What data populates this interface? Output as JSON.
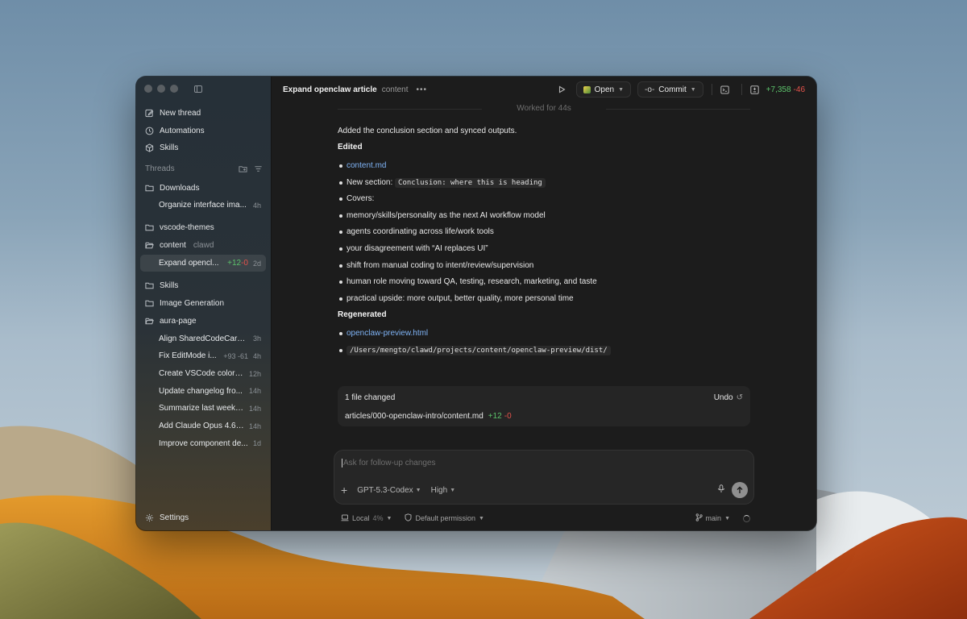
{
  "window": {
    "title": "Expand openclaw article",
    "project": "content"
  },
  "sidebar": {
    "nav": [
      {
        "label": "New thread",
        "icon": "edit-icon"
      },
      {
        "label": "Automations",
        "icon": "clock-icon"
      },
      {
        "label": "Skills",
        "icon": "cube-icon"
      }
    ],
    "threads_header": "Threads",
    "groups": [
      {
        "folder": "Downloads",
        "sub": "",
        "threads": [
          {
            "title": "Organize interface ima...",
            "time": "4h"
          }
        ]
      },
      {
        "folder": "vscode-themes",
        "sub": "",
        "threads": []
      },
      {
        "folder": "content",
        "sub": "clawd",
        "threads": [
          {
            "title": "Expand opencl...",
            "add": "+12",
            "del": "-0",
            "time": "2d",
            "active": true
          }
        ]
      },
      {
        "folder": "Skills",
        "sub": "",
        "threads": []
      },
      {
        "folder": "Image Generation",
        "sub": "",
        "threads": []
      },
      {
        "folder": "aura-page",
        "sub": "",
        "threads": [
          {
            "title": "Align SharedCodeCard ...",
            "time": "3h"
          },
          {
            "title": "Fix EditMode i...",
            "stat": "+93 -61",
            "time": "4h"
          },
          {
            "title": "Create VSCode color t...",
            "time": "12h"
          },
          {
            "title": "Update changelog fro...",
            "time": "14h"
          },
          {
            "title": "Summarize last week P...",
            "time": "14h"
          },
          {
            "title": "Add Claude Opus 4.6 o...",
            "time": "14h"
          },
          {
            "title": "Improve component de...",
            "time": "1d"
          }
        ]
      }
    ],
    "settings_label": "Settings"
  },
  "topbar": {
    "open_label": "Open",
    "commit_label": "Commit",
    "diff_add": "+7,358",
    "diff_del": "-46"
  },
  "conversation": {
    "worked_for": "Worked for 44s",
    "intro": "Added the conclusion section and synced outputs.",
    "edited_heading": "Edited",
    "edited_file": "content.md",
    "new_section_label": "New section:",
    "new_section_code": "Conclusion: where this is heading",
    "covers_label": "Covers:",
    "covers": [
      "memory/skills/personality as the next AI workflow model",
      "agents coordinating across life/work tools",
      "your disagreement with “AI replaces UI”",
      "shift from manual coding to intent/review/supervision",
      "human role moving toward QA, testing, research, marketing, and taste",
      "practical upside: more output, better quality, more personal time"
    ],
    "regenerated_heading": "Regenerated",
    "regenerated_file": "openclaw-preview.html",
    "regenerated_path": "/Users/mengto/clawd/projects/content/openclaw-preview/dist/"
  },
  "changes": {
    "summary": "1 file changed",
    "undo_label": "Undo",
    "file": "articles/000-openclaw-intro/content.md",
    "add": "+12",
    "del": "-0"
  },
  "composer": {
    "placeholder": "Ask for follow-up changes",
    "model": "GPT-5.3-Codex",
    "effort": "High"
  },
  "footer": {
    "env": "Local",
    "env_usage": "4%",
    "permission": "Default permission",
    "branch": "main"
  }
}
